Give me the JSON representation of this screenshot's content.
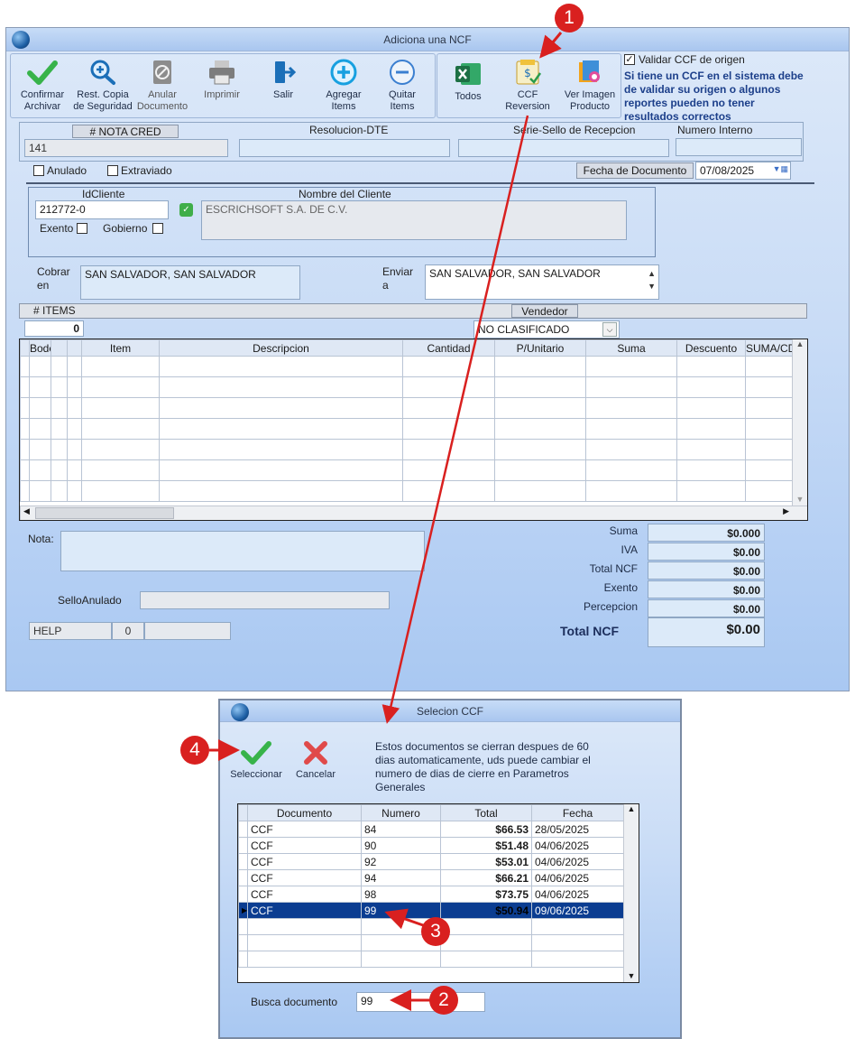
{
  "main": {
    "title": "Adiciona una NCF",
    "toolbar": [
      {
        "label": "Confirmar Archivar",
        "icon": "check-icon"
      },
      {
        "label": "Rest. Copia de Seguridad",
        "icon": "search-zoom-icon"
      },
      {
        "label": "Anular Documento",
        "icon": "cancel-doc-icon"
      },
      {
        "label": "Imprimir",
        "icon": "printer-icon"
      },
      {
        "label": "Salir",
        "icon": "exit-icon"
      },
      {
        "label": "Agregar Items",
        "icon": "plus-circle-icon"
      },
      {
        "label": "Quitar Items",
        "icon": "minus-circle-icon"
      }
    ],
    "toolbar2": [
      {
        "label": "Todos",
        "icon": "excel-icon"
      },
      {
        "label": "CCF Reversion",
        "icon": "ccf-reversion-icon"
      },
      {
        "label": "Ver Imagen Producto",
        "icon": "image-product-icon"
      }
    ],
    "validar_label": "Validar CCF de origen",
    "validar_note": "Si tiene un CCF en el sistema debe de validar su origen o algunos reportes pueden no tener resultados correctos",
    "nota_cred_header": "# NOTA CRED",
    "nota_cred_value": "141",
    "resolucion_label": "Resolucion-DTE",
    "serie_label": "Serie-Sello de Recepcion",
    "numero_interno_label": "Numero Interno",
    "anulado_label": "Anulado",
    "extraviado_label": "Extraviado",
    "fecha_label": "Fecha de  Documento",
    "fecha_value": "07/08/2025",
    "idcliente_label": "IdCliente",
    "idcliente_value": "212772-0",
    "nombre_label": "Nombre del Cliente",
    "nombre_value": "ESCRICHSOFT S.A. DE C.V.",
    "exento_label": "Exento",
    "gobierno_label": "Gobierno",
    "cobrar_label": "Cobrar en",
    "cobrar_value": "SAN SALVADOR, SAN SALVADOR",
    "enviar_label": "Enviar a",
    "enviar_value": "SAN SALVADOR, SAN SALVADOR",
    "items_header": "# ITEMS",
    "items_count": "0",
    "vendedor_label": "Vendedor",
    "vendedor_value": "NO CLASIFICADO",
    "grid_columns": [
      "Bodega",
      "",
      "Item",
      "Descripcion",
      "Cantidad",
      "P/Unitario",
      "Suma",
      "Descuento",
      "SUMA/CD"
    ],
    "nota_label": "Nota:",
    "sello_label": "SelloAnulado",
    "help_label": "HELP",
    "help_count": "0",
    "totals": [
      {
        "label": "Suma",
        "value": "$0.000"
      },
      {
        "label": "IVA",
        "value": "$0.00"
      },
      {
        "label": "Total NCF",
        "value": "$0.00"
      },
      {
        "label": "Exento",
        "value": "$0.00"
      },
      {
        "label": "Percepcion",
        "value": "$0.00"
      }
    ],
    "total_label": "Total NCF",
    "total_value": "$0.00"
  },
  "dialog": {
    "title": "Selecion CCF",
    "select_label": "Seleccionar",
    "cancel_label": "Cancelar",
    "info": "Estos documentos se cierran despues de 60 dias automaticamente, uds puede cambiar el numero de dias de cierre en Parametros Generales",
    "columns": [
      "Documento",
      "Numero",
      "Total",
      "Fecha"
    ],
    "rows": [
      {
        "doc": "CCF",
        "num": "84",
        "total": "$66.53",
        "fecha": "28/05/2025"
      },
      {
        "doc": "CCF",
        "num": "90",
        "total": "$51.48",
        "fecha": "04/06/2025"
      },
      {
        "doc": "CCF",
        "num": "92",
        "total": "$53.01",
        "fecha": "04/06/2025"
      },
      {
        "doc": "CCF",
        "num": "94",
        "total": "$66.21",
        "fecha": "04/06/2025"
      },
      {
        "doc": "CCF",
        "num": "98",
        "total": "$73.75",
        "fecha": "04/06/2025"
      },
      {
        "doc": "CCF",
        "num": "99",
        "total": "$50.94",
        "fecha": "09/06/2025"
      }
    ],
    "busca_label": "Busca documento",
    "busca_value": "99"
  },
  "callouts": [
    "1",
    "2",
    "3",
    "4"
  ],
  "colors": {
    "accent": "#d9201f",
    "selection": "#0b3d91"
  }
}
